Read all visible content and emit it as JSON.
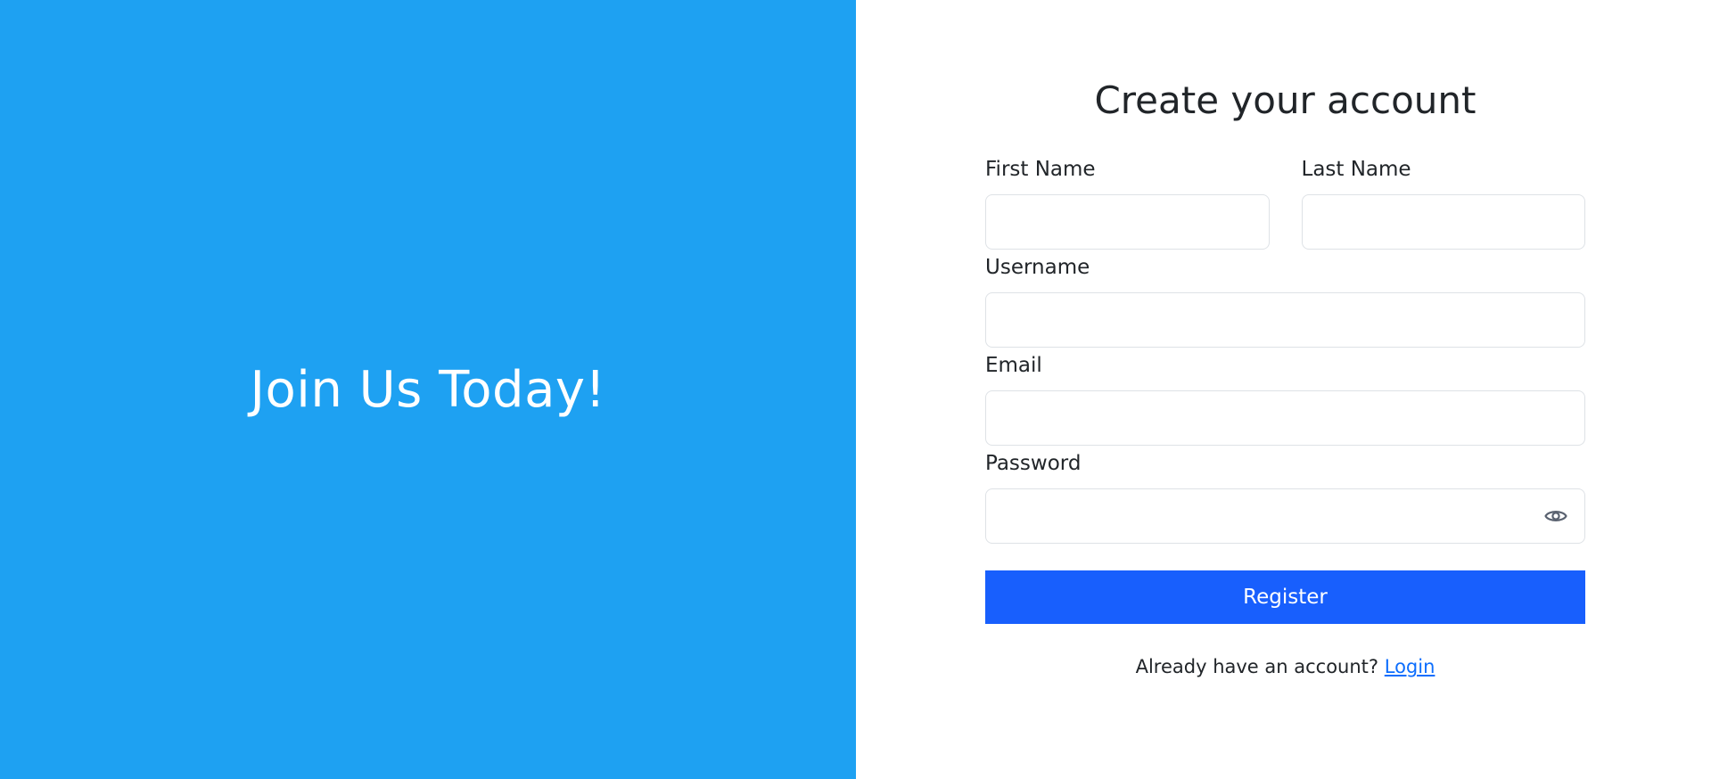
{
  "colors": {
    "left_panel_bg": "#1ea1f2",
    "button_bg": "#185ffd",
    "link": "#0d6efd",
    "eye_icon": "#5a6270"
  },
  "hero": {
    "text": "Join Us Today!"
  },
  "form": {
    "title": "Create your account",
    "first_name": {
      "label": "First Name",
      "value": "",
      "placeholder": ""
    },
    "last_name": {
      "label": "Last Name",
      "value": "",
      "placeholder": ""
    },
    "username": {
      "label": "Username",
      "value": "",
      "placeholder": ""
    },
    "email": {
      "label": "Email",
      "value": "",
      "placeholder": ""
    },
    "password": {
      "label": "Password",
      "value": "",
      "placeholder": "",
      "toggle_icon": "eye-icon"
    },
    "register_label": "Register",
    "footer_text": "Already have an account?",
    "login_link": "Login"
  }
}
